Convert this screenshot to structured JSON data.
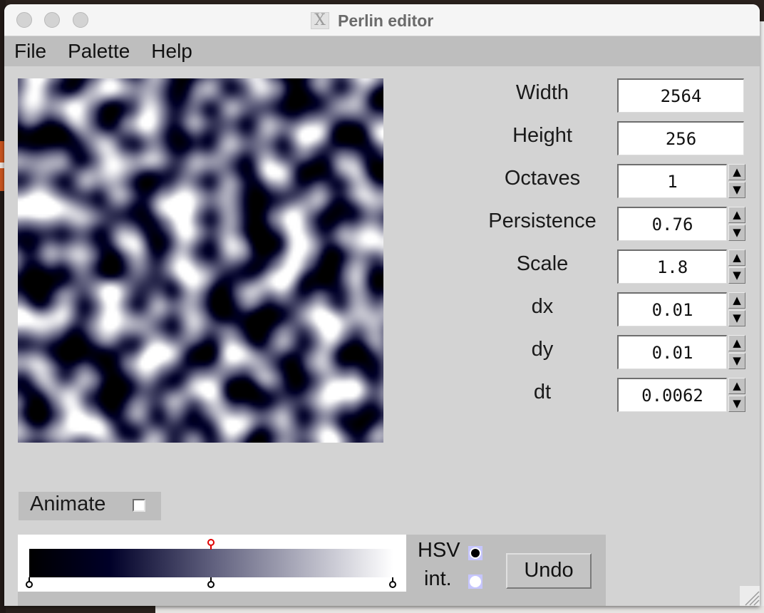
{
  "window": {
    "title": "Perlin editor",
    "title_icon": "x11-icon"
  },
  "menu": {
    "items": [
      {
        "label": "File"
      },
      {
        "label": "Palette"
      },
      {
        "label": "Help"
      }
    ]
  },
  "params": [
    {
      "label": "Width",
      "value": "2564",
      "spinner": false
    },
    {
      "label": "Height",
      "value": "256",
      "spinner": false
    },
    {
      "label": "Octaves",
      "value": "1",
      "spinner": true
    },
    {
      "label": "Persistence",
      "value": "0.76",
      "spinner": true
    },
    {
      "label": "Scale",
      "value": "1.8",
      "spinner": true
    },
    {
      "label": "dx",
      "value": "0.01",
      "spinner": true
    },
    {
      "label": "dy",
      "value": "0.01",
      "spinner": true
    },
    {
      "label": "dt",
      "value": "0.0062",
      "spinner": true
    }
  ],
  "spinner": {
    "up_glyph": "▲",
    "down_glyph": "▼"
  },
  "animate": {
    "label": "Animate",
    "checked": false
  },
  "palette": {
    "stops": [
      {
        "position": 0.0,
        "color": "#000000"
      },
      {
        "position": 0.22,
        "color": "#000028"
      },
      {
        "position": 0.5,
        "color": "#5f5f7d"
      },
      {
        "position": 1.0,
        "color": "#ffffff"
      }
    ],
    "handles": [
      {
        "position": 0.0,
        "selected": false
      },
      {
        "position": 0.5,
        "selected": false
      },
      {
        "position": 1.0,
        "selected": false
      }
    ],
    "selected_handle_position": 0.5,
    "selected_color": "#e00000"
  },
  "mode": {
    "hsv_label": "HSV",
    "int_label": "int.",
    "selected": "HSV"
  },
  "undo": {
    "label": "Undo"
  }
}
